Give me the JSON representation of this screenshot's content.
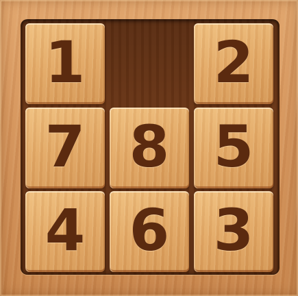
{
  "puzzle": {
    "tiles": [
      {
        "value": "1"
      },
      {
        "value": "2"
      },
      {
        "value": "7"
      },
      {
        "value": "8"
      },
      {
        "value": "5"
      },
      {
        "value": "4"
      },
      {
        "value": "6"
      },
      {
        "value": "3"
      }
    ],
    "grid": [
      [
        "1",
        "",
        "2"
      ],
      [
        "7",
        "8",
        "5"
      ],
      [
        "4",
        "6",
        "3"
      ]
    ],
    "empty_slot": {
      "row": 0,
      "col": 1
    },
    "colors": {
      "frame": "#d4935a",
      "board": "#5a2d12",
      "tile": "#e2a865",
      "digit": "#5b2a0f"
    }
  }
}
